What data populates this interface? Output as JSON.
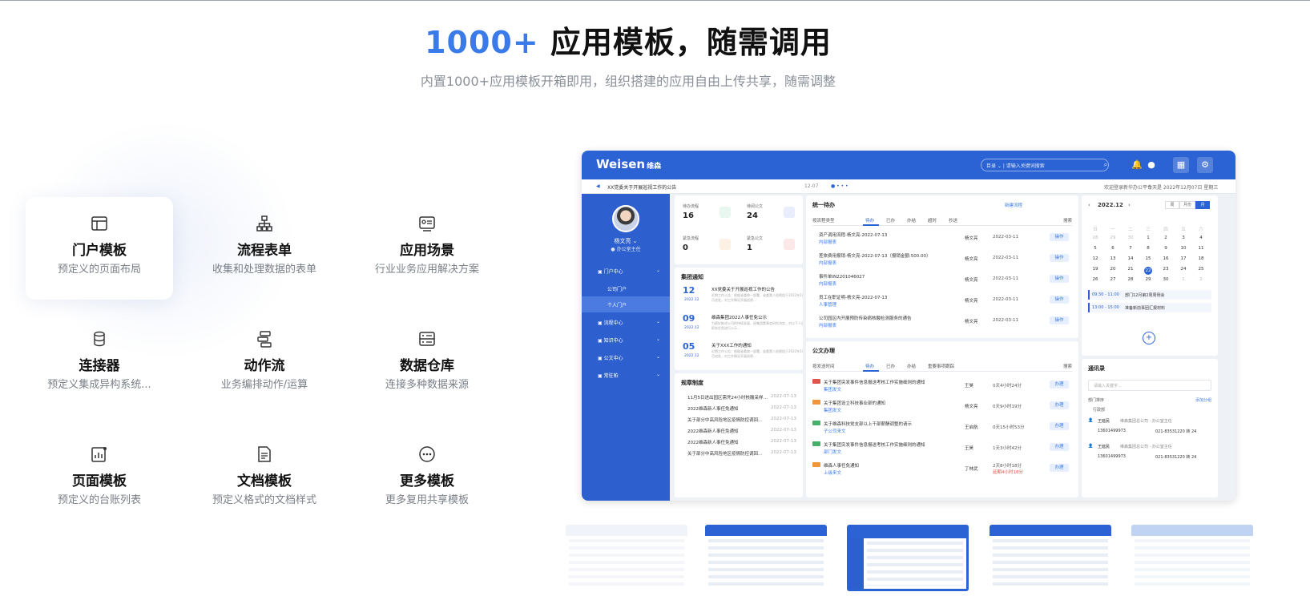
{
  "hero": {
    "title_accent": "1000+",
    "title_rest": " 应用模板，随需调用",
    "subtitle": "内置1000+应用模板开箱即用，组织搭建的应用自由上传共享，随需调整"
  },
  "features": [
    {
      "title": "门户模板",
      "desc": "预定义的页面布局",
      "icon": "layout-icon",
      "active": true
    },
    {
      "title": "流程表单",
      "desc": "收集和处理数据的表单",
      "icon": "flow-tree-icon"
    },
    {
      "title": "应用场景",
      "desc": "行业业务应用解决方案",
      "icon": "scene-card-icon"
    },
    {
      "title": "连接器",
      "desc": "预定义集成异构系统...",
      "icon": "connector-icon"
    },
    {
      "title": "动作流",
      "desc": "业务编排动作/运算",
      "icon": "action-flow-icon"
    },
    {
      "title": "数据仓库",
      "desc": "连接多种数据来源",
      "icon": "data-warehouse-icon"
    },
    {
      "title": "页面模板",
      "desc": "预定义的台账列表",
      "icon": "page-chart-icon"
    },
    {
      "title": "文档模板",
      "desc": "预定义格式的文档样式",
      "icon": "document-icon"
    },
    {
      "title": "更多模板",
      "desc": "更多复用共享模板",
      "icon": "more-dots-icon"
    }
  ],
  "app": {
    "brand": "Weisen",
    "brand_cn": "维森",
    "search_scope": "目录",
    "search_placeholder": "请输入关键词搜索",
    "notice_text": "XX党委关于开展巡视工作的公告",
    "notice_date": "12-07",
    "welcome": "欢迎登录新华办公平台",
    "today": "今天是 2022年12月07日 星期三",
    "user": {
      "name": "杨文亮",
      "role": "办公室主任"
    },
    "menu": [
      {
        "label": "门户中心",
        "arrow": "⌄"
      },
      {
        "label": "公司门户"
      },
      {
        "label": "个人门户"
      },
      {
        "label": "流程中心",
        "arrow": "⌄"
      },
      {
        "label": "知识中心",
        "arrow": "⌄"
      },
      {
        "label": "公文中心",
        "arrow": "⌄"
      },
      {
        "label": "常驻帕",
        "arrow": "⌄"
      }
    ],
    "stats": [
      {
        "label": "待办流程",
        "value": "16",
        "color": "#e8f7ef"
      },
      {
        "label": "待阅公文",
        "value": "24",
        "color": "#e8eefc"
      },
      {
        "label": "紧急流程",
        "value": "0",
        "color": "#fdf1e4"
      },
      {
        "label": "紧急公文",
        "value": "1",
        "color": "#fde8e8"
      }
    ],
    "group_notice": {
      "title": "集团通知",
      "items": [
        {
          "day": "12",
          "ym": "2022.12",
          "title": "XX党委关于开展巡视工作的公告",
          "desc": "近期工作公告：根据省委统一部署，省委第八巡视组于2022年10月进驻，对工作情况开展巡视..."
        },
        {
          "day": "09",
          "ym": "2022.12",
          "title": "维森集团2022人事任免公示",
          "desc": "为更好推进公司的持续发展，经集团董事会研究决定，对以下人员职务任免进行公示..."
        },
        {
          "day": "05",
          "ym": "2022.12",
          "title": "关于XXX工作的通知",
          "desc": "近期工作公告：根据省委统一部署，省委第八巡视组于2022年10月进驻，对工作情况开展巡视..."
        }
      ]
    },
    "rules": {
      "title": "规章制度",
      "items": [
        {
          "text": "11月5日进出园区需凭24小时核酸采样…",
          "date": "2022-07-13"
        },
        {
          "text": "2022维森新人事任免通知",
          "date": "2022-07-13"
        },
        {
          "text": "关于部分中高风险地区疫情防控调回…",
          "date": "2022-07-13"
        },
        {
          "text": "2022维森新人事任免通知",
          "date": "2022-07-13"
        },
        {
          "text": "2022维森新人事任免通知",
          "date": "2022-07-13"
        },
        {
          "text": "关于部分中高风险地区疫情防控调回…",
          "date": "2022-07-13"
        }
      ]
    },
    "todo": {
      "title": "统一待办",
      "new_label": "新建流程",
      "filter": "按流程类型",
      "tabs": [
        "待办",
        "已办",
        "办结",
        "超时",
        "抄送"
      ],
      "search": "搜索",
      "rows": [
        {
          "title": "资产调用流程-杨文亮-2022-07-13",
          "sub": "内部报表",
          "who": "杨文亮",
          "date": "2022-03-11",
          "op": "操作"
        },
        {
          "title": "差旅费用报销-杨文亮-2022-07-13（报销金额:500.00）",
          "sub": "内部报表",
          "who": "杨文亮",
          "date": "2022-03-11",
          "op": "操作"
        },
        {
          "title": "事件单IN2201046027",
          "sub": "内部报表",
          "who": "杨文亮",
          "date": "2022-03-11",
          "op": "操作"
        },
        {
          "title": "员工在职证明-杨文亮-2022-07-13",
          "sub": "人事管理",
          "who": "杨文亮",
          "date": "2022-03-11",
          "op": "操作"
        },
        {
          "title": "公司园区内开展预防传染病核酸检测服务的通告",
          "sub": "内部报表",
          "who": "杨文亮",
          "date": "2022-03-11",
          "op": "操作"
        }
      ]
    },
    "docs": {
      "title": "公文办理",
      "filter": "按发送时间",
      "tabs": [
        "待办",
        "已办",
        "办结",
        "重要事项跟踪"
      ],
      "search": "搜索",
      "rows": [
        {
          "tag_color": "#e0554a",
          "title": "关于集团突发事件信息报送考核工作实施细则的通知",
          "sub": "集团发文",
          "who": "王昊",
          "date": "0天4小时24分",
          "op": "办理"
        },
        {
          "tag_color": "#f0953a",
          "title": "关于集团设立科技事业部的通知",
          "sub": "集团发文",
          "who": "杨文亮",
          "date": "0天9小时19分",
          "op": "办理"
        },
        {
          "tag_color": "#46b06b",
          "title": "关于维森科技党支部以上干部薪酬调整的请示",
          "sub": "子公司来文",
          "who": "王启航",
          "date": "0天15小时53分",
          "op": "办理"
        },
        {
          "tag_color": "#46b06b",
          "title": "关于集团突发事件信息报送考核工作实施细则的通知",
          "sub": "部门发文",
          "who": "王昊",
          "date": "1天3小时42分",
          "op": "办理"
        },
        {
          "tag_color": "#f0953a",
          "title": "维森人事任免通知",
          "sub": "上级来文",
          "who": "丁林武",
          "date": "2天8小时18分",
          "overdue": "延期4小时18分",
          "op": "办理"
        }
      ]
    },
    "calendar": {
      "month": "2022.12",
      "modes": [
        "周",
        "月份",
        "月"
      ],
      "weekdays": [
        "日",
        "一",
        "二",
        "三",
        "四",
        "五",
        "六"
      ],
      "weeks": [
        [
          "28",
          "29",
          "30",
          "1",
          "2",
          "3",
          "4"
        ],
        [
          "5",
          "6",
          "7",
          "8",
          "9",
          "10",
          "11"
        ],
        [
          "12",
          "13",
          "14",
          "15",
          "16",
          "17",
          "18"
        ],
        [
          "19",
          "20",
          "21",
          "22",
          "23",
          "24",
          "25"
        ],
        [
          "26",
          "27",
          "28",
          "29",
          "30",
          "1",
          "2"
        ]
      ],
      "today": "22",
      "events": [
        {
          "time": "09:30 - 11:00",
          "text": "部门12月第2周周例会"
        },
        {
          "time": "13:00 - 15:00",
          "text": "准备新前事团汇报材料"
        }
      ],
      "add": "+"
    },
    "contacts": {
      "title": "通讯录",
      "search_placeholder": "请输入关键字...",
      "dept": "部门排序",
      "add_group": "添加分组",
      "group": "行政部",
      "people": [
        {
          "name": "王延民",
          "dept": "维森集团总公司 · 办公室主任",
          "mobile": "13601499973",
          "tel": "021-83531220 转 24"
        },
        {
          "name": "王延民",
          "dept": "维森集团总公司 · 办公室主任",
          "mobile": "13601499973",
          "tel": "021-83531220 转 24"
        }
      ]
    }
  },
  "thumbnails": [
    "template-thumb-1",
    "template-thumb-2",
    "template-thumb-3",
    "template-thumb-4",
    "template-thumb-5"
  ],
  "colors": {
    "accent": "#3b7be9",
    "brand_blue": "#2c63d4",
    "sidebar_blue": "#2e5fcf"
  }
}
